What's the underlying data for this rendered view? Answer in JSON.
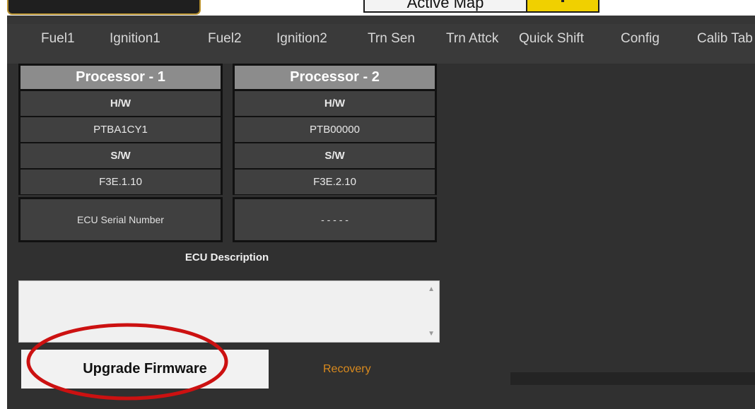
{
  "top": {
    "map_label": "Active Map"
  },
  "menu": [
    {
      "label": "Fuel1"
    },
    {
      "label": "Ignition1"
    },
    {
      "label": "Fuel2"
    },
    {
      "label": "Ignition2"
    },
    {
      "label": "Trn Sen"
    },
    {
      "label": "Trn Attck"
    },
    {
      "label": "Quick Shift"
    },
    {
      "label": "Config"
    },
    {
      "label": "Calib Tab"
    }
  ],
  "processors": [
    {
      "title": "Processor - 1",
      "hw_label": "H/W",
      "hw_value": "PTBA1CY1",
      "sw_label": "S/W",
      "sw_value": "F3E.1.10"
    },
    {
      "title": "Processor - 2",
      "hw_label": "H/W",
      "hw_value": "PTB00000",
      "sw_label": "S/W",
      "sw_value": "F3E.2.10"
    }
  ],
  "serial": {
    "label": "ECU Serial Number",
    "value": "- - - - -"
  },
  "description": {
    "label": "ECU Description",
    "value": ""
  },
  "actions": {
    "upgrade_label": "Upgrade Firmware",
    "recovery_label": "Recovery"
  },
  "colors": {
    "background": "#303030",
    "header_cell": "#8c8c8c",
    "recovery_text": "#d98a1e",
    "highlight_circle": "#cc1111"
  }
}
